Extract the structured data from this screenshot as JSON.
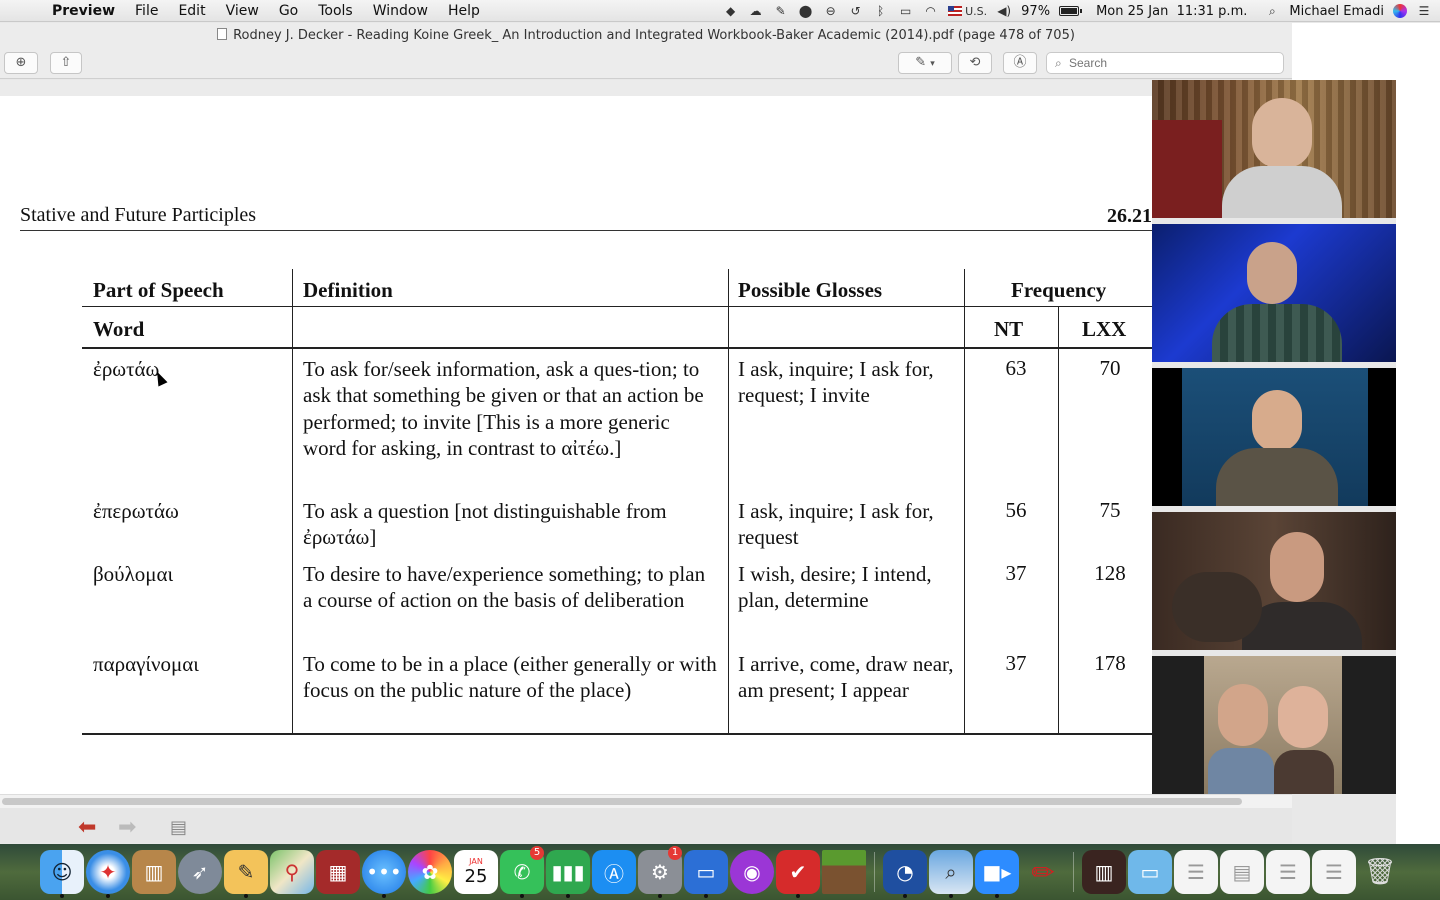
{
  "menubar": {
    "app_name": "Preview",
    "items": [
      "File",
      "Edit",
      "View",
      "Go",
      "Tools",
      "Window",
      "Help"
    ],
    "input_source": "U.S.",
    "battery_percent": "97%",
    "datetime": "Mon 25 Jan  11:31 p.m.",
    "user_name": "Michael Emadi"
  },
  "window": {
    "title": "Rodney J. Decker - Reading Koine Greek_ An Introduction and Integrated Workbook-Baker Academic (2014).pdf (page 478 of 705)",
    "search_placeholder": "Search"
  },
  "document": {
    "running_head": "Stative and Future Participles",
    "section_number": "26.21",
    "table": {
      "headers": {
        "part_of_speech": "Part of Speech",
        "definition": "Definition",
        "glosses": "Possible Glosses",
        "frequency": "Frequency",
        "word": "Word",
        "nt": "NT",
        "lxx": "LXX"
      },
      "rows": [
        {
          "word": "ἐρωτάω",
          "definition": "To ask for/seek information, ask a ques-tion; to ask that something be given or that an action be performed; to invite [This is a more generic word for asking, in contrast to αἰτέω.]",
          "glosses": "I ask, inquire; I ask for, request; I invite",
          "nt": "63",
          "lxx": "70"
        },
        {
          "word": "ἐπερωτάω",
          "definition": "To ask a question [not distinguishable from ἐρωτάω]",
          "glosses": "I ask, inquire; I ask for, request",
          "nt": "56",
          "lxx": "75"
        },
        {
          "word": "βούλομαι",
          "definition": "To desire to have/experience something; to plan a course of action on the basis of deliberation",
          "glosses": "I wish, desire; I intend, plan, determine",
          "nt": "37",
          "lxx": "128"
        },
        {
          "word": "παραγίνομαι",
          "definition": "To come to be in a place (either generally or with focus on the public nature of the place)",
          "glosses": "I arrive, come, draw near, am present; I appear",
          "nt": "37",
          "lxx": "178"
        }
      ]
    }
  },
  "dock": {
    "calendar_month": "JAN",
    "calendar_day": "25",
    "facetime_badge": "5",
    "prefs_badge": "1"
  }
}
